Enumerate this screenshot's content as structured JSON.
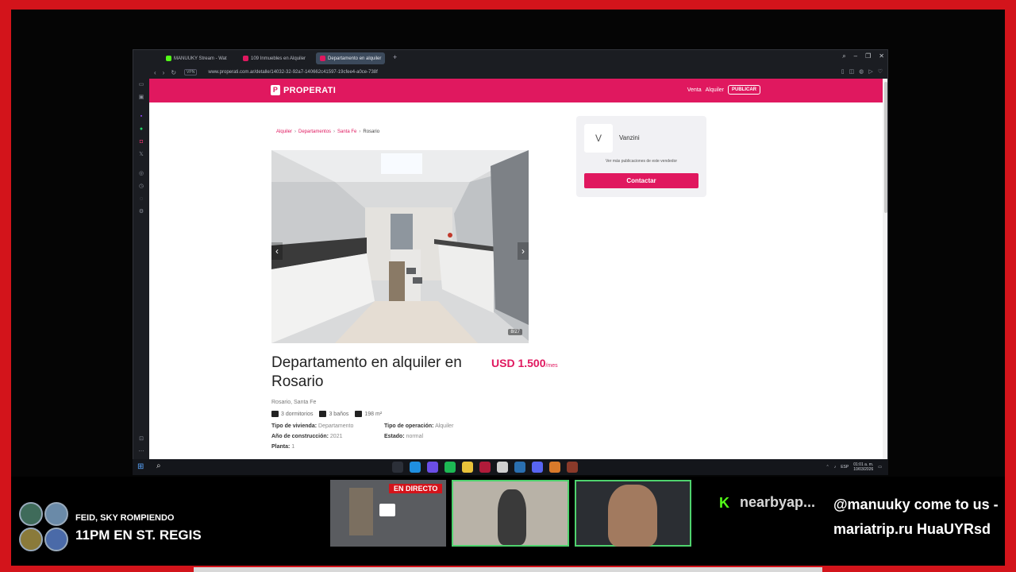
{
  "browser": {
    "tabs": [
      {
        "label": "MANUUKY Stream - Wat",
        "color": "#53fc18"
      },
      {
        "label": "109 Inmuebles en Alquiler",
        "color": "#e0185f"
      },
      {
        "label": "Departamento en alquiler",
        "color": "#e0185f"
      }
    ],
    "new_tab": "+",
    "vpn": "VPN",
    "url": "www.properati.com.ar/detalle/14032-32-92a7-140662c41597-19cfee4-a0ce-738f"
  },
  "site": {
    "logo": "PROPERATI",
    "logo_mark": "P",
    "nav": {
      "venta": "Venta",
      "alquiler": "Alquiler",
      "publicar": "PUBLICAR"
    }
  },
  "breadcrumb": {
    "items": [
      "Alquiler",
      "Departamentos",
      "Santa Fe"
    ],
    "current": "Rosario",
    "separator": "›"
  },
  "gallery": {
    "counter": "8/27",
    "prev": "‹",
    "next": "›"
  },
  "listing": {
    "title": "Departamento en alquiler en Rosario",
    "price": "USD 1.500",
    "price_suffix": "/mes",
    "location": "Rosario, Santa Fe",
    "features": {
      "dormitorios": "3 dormitorios",
      "banos": "3 baños",
      "area": "198 m²"
    },
    "details": {
      "tipo_vivienda_label": "Tipo de vivienda:",
      "tipo_vivienda": "Departamento",
      "tipo_operacion_label": "Tipo de operación:",
      "tipo_operacion": "Alquiler",
      "anio_label": "Año de construcción:",
      "anio": "2021",
      "estado_label": "Estado:",
      "estado": "normal",
      "planta_label": "Planta:",
      "planta": "1"
    }
  },
  "seller": {
    "initial": "V",
    "name": "Vanzini",
    "link": "Ver más publicaciones de este vendedor",
    "contact": "Contactar"
  },
  "taskbar": {
    "lang": "ESP",
    "time": "01:01 a. m.",
    "date": "10/03/2026"
  },
  "overlay": {
    "event_line1": "FEID, SKY ROMPIENDO",
    "event_line2": "11PM EN ST. REGIS",
    "live": "EN DIRECTO",
    "chat_user": "nearbyap...",
    "chat_message": "@manuuky come to us - mariatrip.ru HuaUYRsd",
    "kick_icon": "K"
  },
  "colors": {
    "brand": "#e0185f",
    "frame": "#d3141b",
    "kick": "#53fc18"
  }
}
